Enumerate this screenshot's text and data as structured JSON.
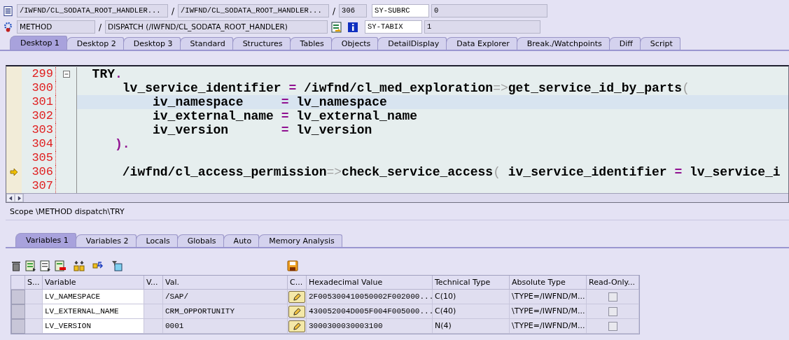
{
  "header": {
    "program": "/IWFND/CL_SODATA_ROOT_HANDLER...",
    "include": "/IWFND/CL_SODATA_ROOT_HANDLER...",
    "line": "306",
    "sy_fields": [
      {
        "name": "SY-SUBRC",
        "value": "0"
      },
      {
        "name": "SY-TABIX",
        "value": "1"
      }
    ],
    "event_type": "METHOD",
    "event": "DISPATCH (/IWFND/CL_SODATA_ROOT_HANDLER)",
    "separators": [
      "/",
      "/",
      "/"
    ]
  },
  "tabs": [
    {
      "label": "Desktop 1",
      "selected": true
    },
    {
      "label": "Desktop 2",
      "selected": false
    },
    {
      "label": "Desktop 3",
      "selected": false
    },
    {
      "label": "Standard",
      "selected": false
    },
    {
      "label": "Structures",
      "selected": false
    },
    {
      "label": "Tables",
      "selected": false
    },
    {
      "label": "Objects",
      "selected": false
    },
    {
      "label": "DetailDisplay",
      "selected": false
    },
    {
      "label": "Data Explorer",
      "selected": false
    },
    {
      "label": "Break./Watchpoints",
      "selected": false
    },
    {
      "label": "Diff",
      "selected": false
    },
    {
      "label": "Script",
      "selected": false
    }
  ],
  "code": [
    {
      "number": "299",
      "foldable": true,
      "current": false,
      "highlighted": false,
      "segments": [
        {
          "kind": "code",
          "text": "  TRY"
        },
        {
          "kind": "op",
          "text": "."
        }
      ]
    },
    {
      "number": "300",
      "foldable": false,
      "current": false,
      "highlighted": false,
      "segments": [
        {
          "kind": "code",
          "text": "      lv_service_identifier "
        },
        {
          "kind": "op",
          "text": "="
        },
        {
          "kind": "code",
          "text": " /iwfnd/cl_med_exploration"
        },
        {
          "kind": "dim",
          "text": "=>"
        },
        {
          "kind": "code",
          "text": "get_service_id_by_parts"
        },
        {
          "kind": "dim",
          "text": "("
        }
      ]
    },
    {
      "number": "301",
      "foldable": false,
      "current": false,
      "highlighted": true,
      "segments": [
        {
          "kind": "code",
          "text": "          iv_namespace     "
        },
        {
          "kind": "op",
          "text": "="
        },
        {
          "kind": "code",
          "text": " lv_namespace"
        }
      ]
    },
    {
      "number": "302",
      "foldable": false,
      "current": false,
      "highlighted": false,
      "segments": [
        {
          "kind": "code",
          "text": "          iv_external_name "
        },
        {
          "kind": "op",
          "text": "="
        },
        {
          "kind": "code",
          "text": " lv_external_name"
        }
      ]
    },
    {
      "number": "303",
      "foldable": false,
      "current": false,
      "highlighted": false,
      "segments": [
        {
          "kind": "code",
          "text": "          iv_version       "
        },
        {
          "kind": "op",
          "text": "="
        },
        {
          "kind": "code",
          "text": " lv_version"
        }
      ]
    },
    {
      "number": "304",
      "foldable": false,
      "current": false,
      "highlighted": false,
      "segments": [
        {
          "kind": "op",
          "text": "     )."
        }
      ]
    },
    {
      "number": "305",
      "foldable": false,
      "current": false,
      "highlighted": false
    },
    {
      "number": "306",
      "foldable": false,
      "current": true,
      "highlighted": false,
      "segments": [
        {
          "kind": "code",
          "text": "      /iwfnd/cl_access_permission"
        },
        {
          "kind": "dim",
          "text": "=>"
        },
        {
          "kind": "code",
          "text": "check_service_access"
        },
        {
          "kind": "dim",
          "text": "("
        },
        {
          "kind": "code",
          "text": " iv_service_identifier "
        },
        {
          "kind": "op",
          "text": "="
        },
        {
          "kind": "code",
          "text": " lv_service_i"
        }
      ]
    },
    {
      "number": "307",
      "foldable": false,
      "current": false,
      "highlighted": false
    }
  ],
  "scope": "Scope \\METHOD dispatch\\TRY",
  "var_tabs": [
    {
      "label": "Variables 1",
      "selected": true
    },
    {
      "label": "Variables 2",
      "selected": false
    },
    {
      "label": "Locals",
      "selected": false
    },
    {
      "label": "Globals",
      "selected": false
    },
    {
      "label": "Auto",
      "selected": false
    },
    {
      "label": "Memory Analysis",
      "selected": false
    }
  ],
  "table": {
    "columns": [
      "S...",
      "Variable",
      "V...",
      "Val.",
      "C...",
      "Hexadecimal Value",
      "Technical Type",
      "Absolute Type",
      "Read-Only..."
    ],
    "rows": [
      {
        "variable": "LV_NAMESPACE",
        "value": "/SAP/",
        "hex": "2F005300410050002F002000...",
        "technical_type": "C(10)",
        "absolute_type": "\\TYPE=/IWFND/M...",
        "read_only": false
      },
      {
        "variable": "LV_EXTERNAL_NAME",
        "value": "CRM_OPPORTUNITY",
        "hex": "430052004D005F004F005000...",
        "technical_type": "C(40)",
        "absolute_type": "\\TYPE=/IWFND/M...",
        "read_only": false
      },
      {
        "variable": "LV_VERSION",
        "value": "0001",
        "hex": "3000300030003100",
        "technical_type": "N(4)",
        "absolute_type": "\\TYPE=/IWFND/M...",
        "read_only": false
      }
    ]
  }
}
